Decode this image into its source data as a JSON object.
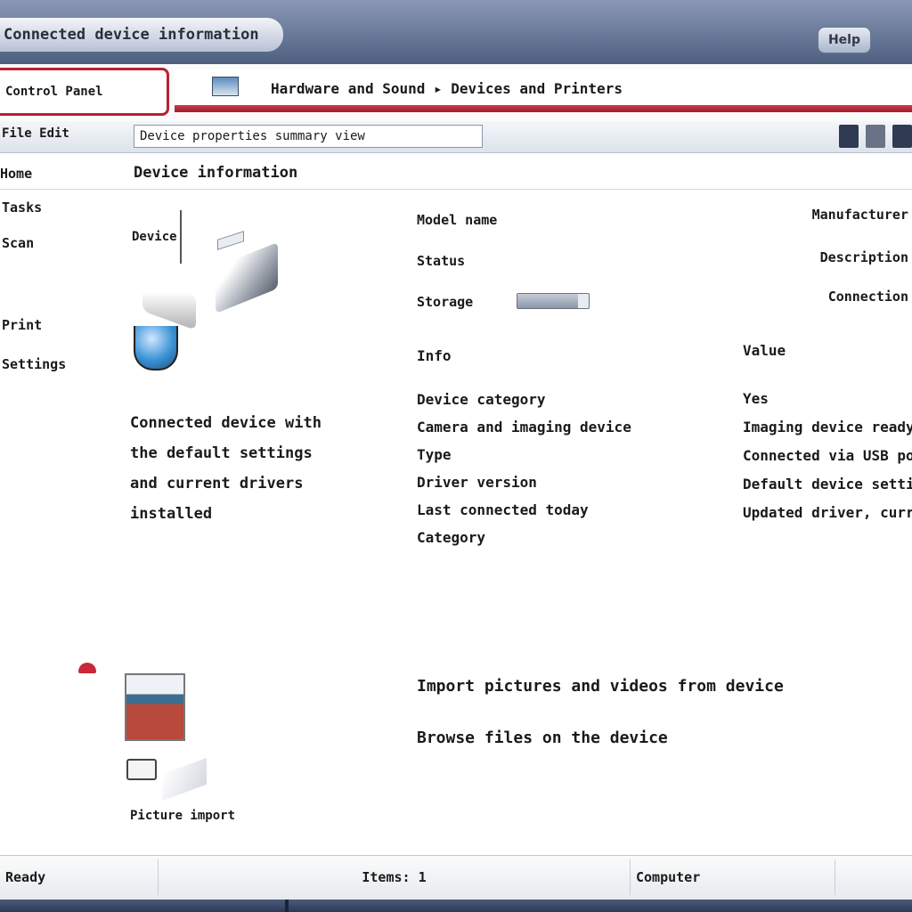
{
  "window": {
    "title": "Connected device information",
    "title_button": "Help"
  },
  "address": {
    "left_label": "Control Panel",
    "path": "Hardware and Sound ▸ Devices and Printers"
  },
  "toolbar": {
    "left_label": "File Edit",
    "path": "Device properties summary view",
    "icons": [
      "view-icon",
      "help-icon",
      "close-icon"
    ]
  },
  "page": {
    "nav_top": "Home",
    "heading": "Device information"
  },
  "sidebar": {
    "items": [
      {
        "label": "Tasks"
      },
      {
        "label": "Scan"
      },
      {
        "label": "Print"
      },
      {
        "label": "Settings"
      }
    ]
  },
  "device": {
    "label": "Device"
  },
  "description": {
    "lines": [
      "Connected device with",
      "the default settings",
      "and current drivers",
      "installed"
    ]
  },
  "details": {
    "model_label": "Model name",
    "status_label": "Status",
    "storage_label": "Storage",
    "storage_progress": 0.85
  },
  "right_info": {
    "lines": [
      "Manufacturer",
      "Description",
      "Connection"
    ]
  },
  "properties": {
    "heading": "Info",
    "lines": [
      "Device category",
      "Camera and imaging device",
      "Type",
      "Driver version",
      "Last connected today",
      "Category"
    ]
  },
  "right_properties": {
    "heading": "Value",
    "lines": [
      "Yes",
      "Imaging device ready",
      "Connected via USB port",
      "Default device settings",
      "Updated driver, current version"
    ]
  },
  "lower": {
    "caption": "Picture import",
    "line1": "Import pictures and videos from device",
    "line2": "Browse files on the device"
  },
  "statusbar": {
    "left": "Ready",
    "center": "Items: 1",
    "right": "Computer"
  }
}
